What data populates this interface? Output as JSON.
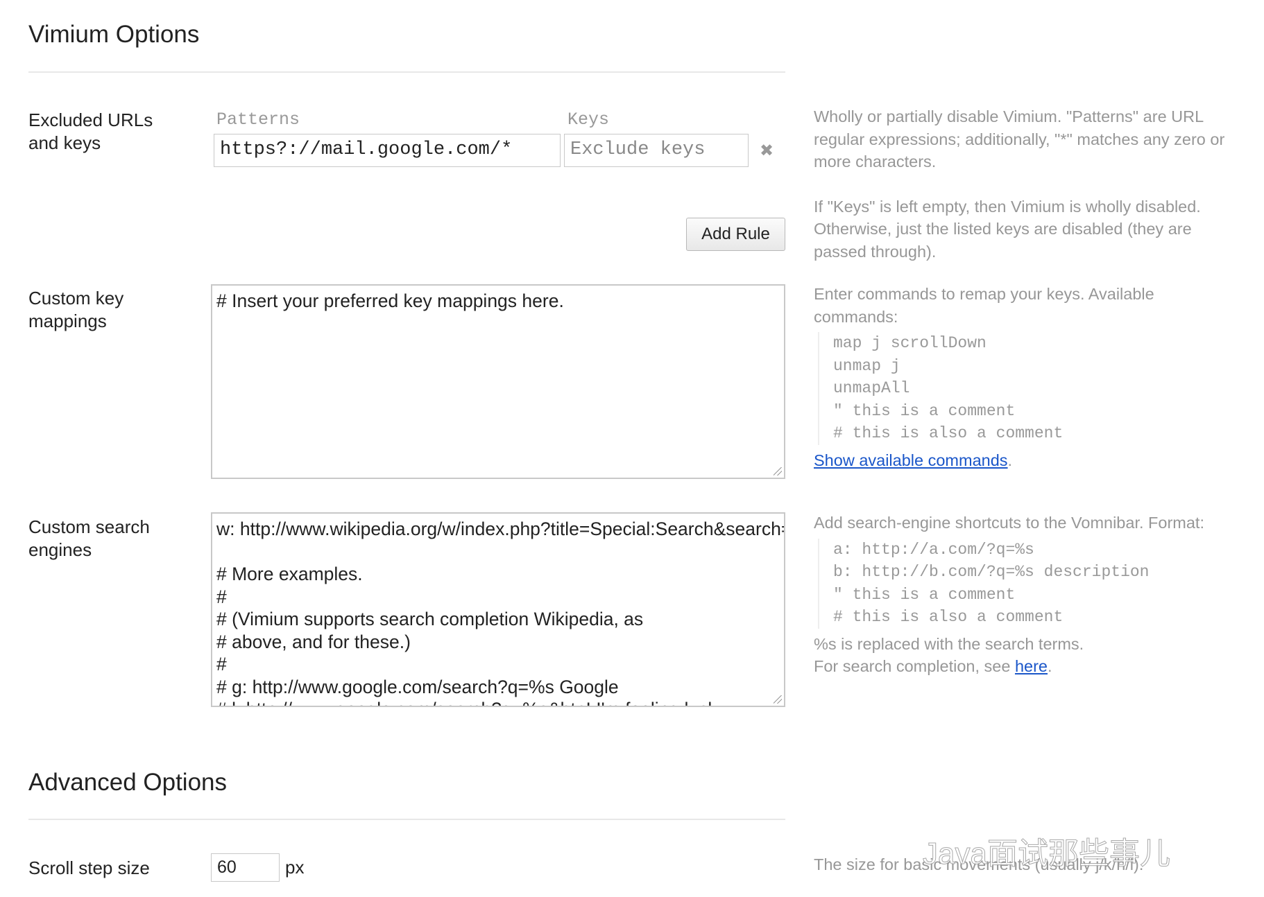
{
  "title": "Vimium Options",
  "excluded": {
    "label": "Excluded URLs and keys",
    "patterns_header": "Patterns",
    "keys_header": "Keys",
    "pattern_value": "https?://mail.google.com/*",
    "keys_placeholder": "Exclude keys",
    "remove_icon": "✖",
    "add_rule": "Add Rule",
    "help1": "Wholly or partially disable Vimium. \"Patterns\" are URL regular expressions; additionally, \"*\" matches any zero or more characters.",
    "help2": "If \"Keys\" is left empty, then Vimium is wholly disabled. Otherwise, just the listed keys are disabled (they are passed through)."
  },
  "key_mappings": {
    "label": "Custom key mappings",
    "value": "# Insert your preferred key mappings here.",
    "help": "Enter commands to remap your keys. Available commands:",
    "examples": "map j scrollDown\nunmap j\nunmapAll\n\" this is a comment\n# this is also a comment",
    "link": "Show available commands",
    "link_suffix": "."
  },
  "search_engines": {
    "label": "Custom search engines",
    "value": "w: http://www.wikipedia.org/w/index.php?title=Special:Search&search=%s Wikipedia\n\n# More examples.\n#\n# (Vimium supports search completion Wikipedia, as\n# above, and for these.)\n#\n# g: http://www.google.com/search?q=%s Google\n# l: http://www.google.com/search?q=%s&btnI I'm feeling lucky...",
    "help": "Add search-engine shortcuts to the Vomnibar. Format:",
    "examples": "a: http://a.com/?q=%s\nb: http://b.com/?q=%s description\n\" this is a comment\n# this is also a comment",
    "help2": "%s is replaced with the search terms.",
    "help3": "For search completion, see ",
    "link": "here",
    "link_suffix": "."
  },
  "advanced": {
    "title": "Advanced Options",
    "scroll_label": "Scroll step size",
    "scroll_value": "60",
    "scroll_unit": "px",
    "scroll_help": "The size for basic movements (usually j/k/h/l)."
  },
  "watermark": "Java面试那些事儿"
}
